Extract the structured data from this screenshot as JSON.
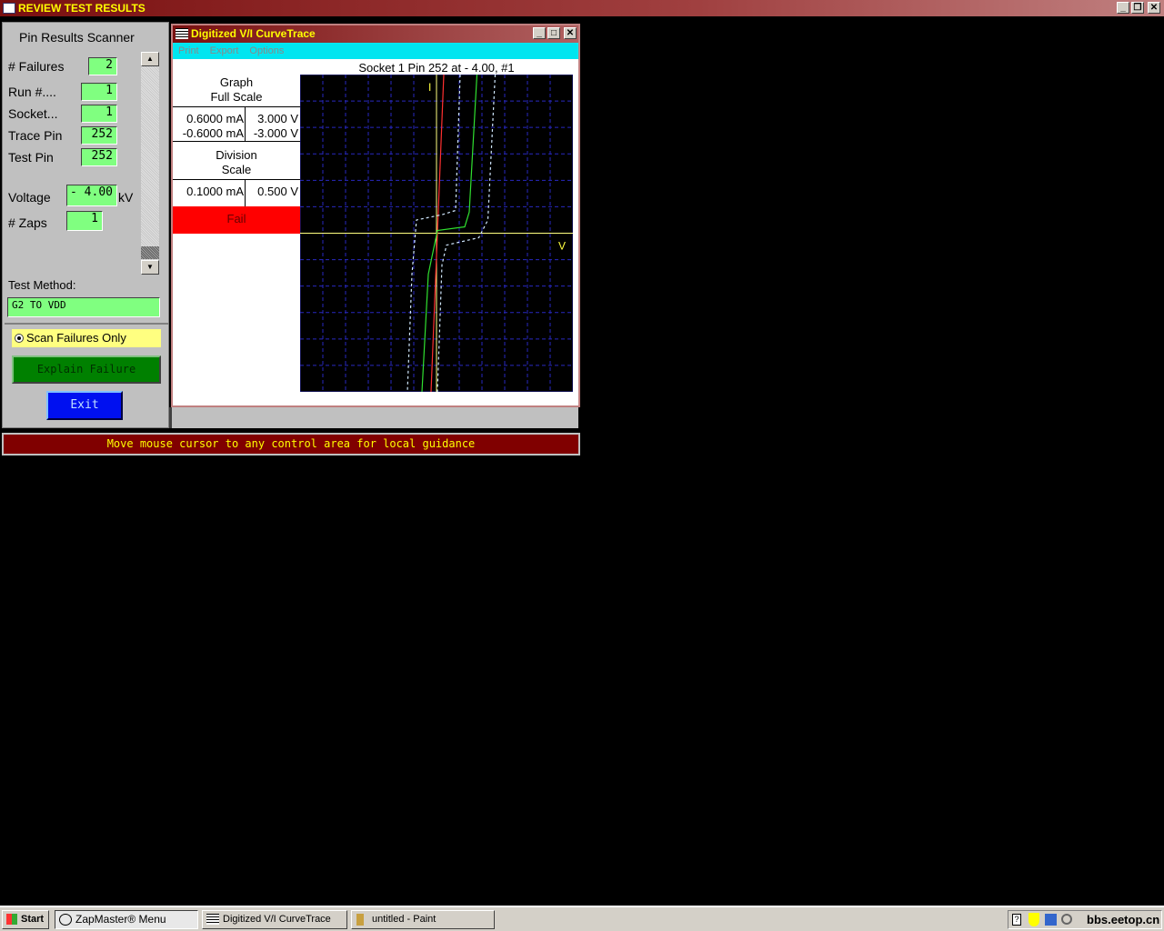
{
  "window": {
    "title": "REVIEW TEST RESULTS"
  },
  "scanner": {
    "title": "Pin Results Scanner",
    "failures_label": "# Failures",
    "failures": "2",
    "run_label": "Run #....",
    "run": "1",
    "socket_label": "Socket...",
    "socket": "1",
    "trace_pin_label": "Trace Pin",
    "trace_pin": "252",
    "test_pin_label": "Test Pin",
    "test_pin": "252",
    "voltage_label": "Voltage",
    "voltage": "- 4.00",
    "voltage_unit": "kV",
    "zaps_label": "# Zaps",
    "zaps": "1",
    "method_label": "Test Method:",
    "method": "G2 TO VDD",
    "scan_only": "Scan Failures Only",
    "explain": "Explain Failure",
    "exit": "Exit"
  },
  "curve": {
    "title": "Digitized V/I CurveTrace",
    "menu": [
      "Print",
      "Export",
      "Options"
    ],
    "graph_title": "Socket 1 Pin 252 at - 4.00, #1",
    "full_scale_label1": "Graph",
    "full_scale_label2": "Full Scale",
    "i_max": "0.6000 mA",
    "i_min": "-0.6000 mA",
    "v_max": "3.000 V",
    "v_min": "-3.000 V",
    "div_label1": "Division",
    "div_label2": "Scale",
    "i_div": "0.1000 mA",
    "v_div": "0.500 V",
    "result": "Fail",
    "axis_i": "I",
    "axis_v": "V"
  },
  "chart_data": {
    "type": "line",
    "title": "Socket 1 Pin 252 at - 4.00, #1",
    "xlabel": "V",
    "ylabel": "I",
    "xlim": [
      -3,
      3
    ],
    "ylim": [
      -0.6,
      0.6
    ],
    "x_div": 0.5,
    "y_div": 0.1,
    "grid": true,
    "series": [
      {
        "name": "trace",
        "color": "#ff3030",
        "dashed": false,
        "points": [
          [
            0.16,
            0.6
          ],
          [
            0.02,
            0
          ],
          [
            -0.12,
            -0.6
          ]
        ]
      },
      {
        "name": "reference",
        "color": "#30e030",
        "dashed": false,
        "points": [
          [
            0.89,
            0.6
          ],
          [
            0.72,
            0.08
          ],
          [
            0.62,
            0.024
          ],
          [
            0.02,
            0.01
          ],
          [
            -0.18,
            -0.155
          ],
          [
            -0.32,
            -0.6
          ]
        ]
      },
      {
        "name": "limit-low",
        "color": "#d0e8ff",
        "dashed": true,
        "points": [
          [
            0.52,
            0.6
          ],
          [
            0.42,
            0.086
          ],
          [
            0.12,
            0.07
          ],
          [
            -0.44,
            0.05
          ],
          [
            -0.54,
            -0.155
          ],
          [
            -0.64,
            -0.6
          ]
        ]
      },
      {
        "name": "limit-high",
        "color": "#d0e8ff",
        "dashed": true,
        "points": [
          [
            1.29,
            0.6
          ],
          [
            1.13,
            0.05
          ],
          [
            0.93,
            -0.017
          ],
          [
            0.22,
            -0.045
          ],
          [
            0.12,
            -0.12
          ],
          [
            0.02,
            -0.6
          ]
        ]
      }
    ]
  },
  "status": {
    "text": "Move mouse cursor to any control area for local guidance"
  },
  "taskbar": {
    "start": "Start",
    "items": [
      "ZapMaster® Menu",
      "Digitized V/I CurveTrace",
      "untitled - Paint"
    ],
    "tray": "bbs.eetop.cn"
  }
}
